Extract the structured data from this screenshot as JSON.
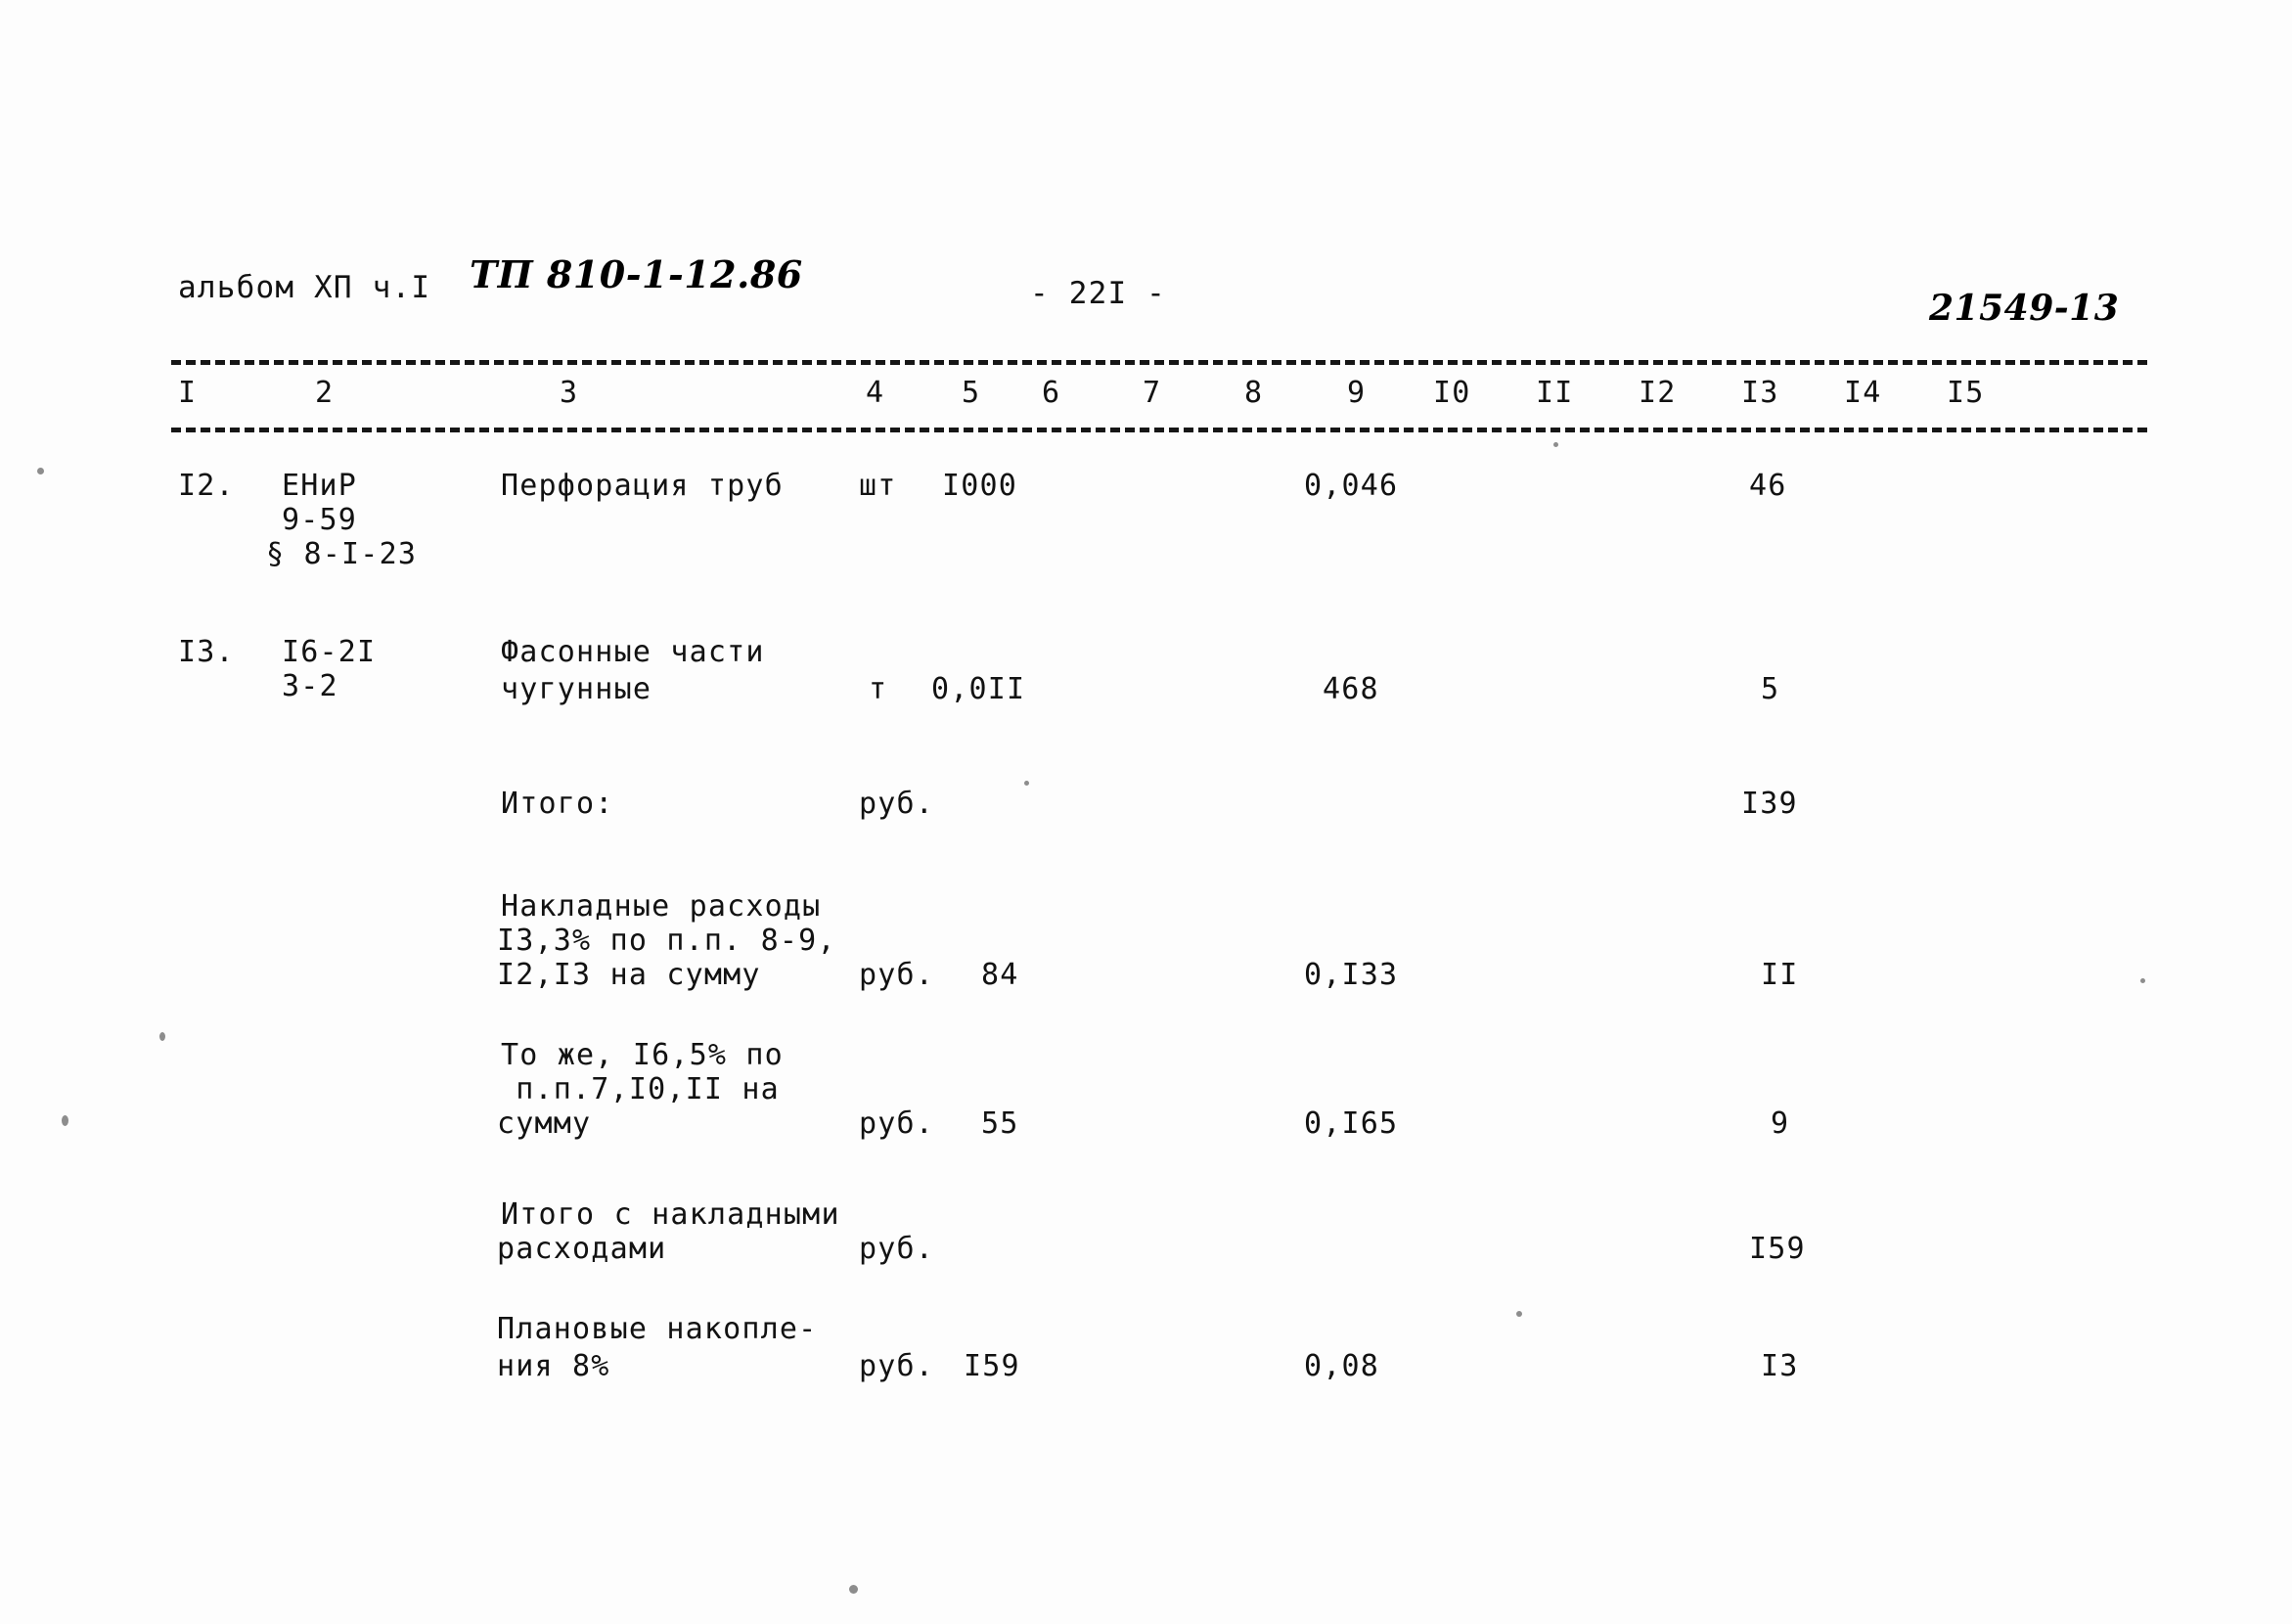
{
  "document": {
    "album_line": "альбом ХП ч.I",
    "project_code_handwritten": "ТП 810-1-12.86",
    "page_number": "- 22I -",
    "stamp_handwritten": "21549-13"
  },
  "table": {
    "column_headers": [
      "I",
      "2",
      "3",
      "4",
      "5",
      "6",
      "7",
      "8",
      "9",
      "I0",
      "II",
      "I2",
      "I3",
      "I4",
      "I5"
    ],
    "rows": [
      {
        "no": "I2.",
        "code_lines": [
          "ЕНиР",
          "9-59",
          "§ 8-I-23"
        ],
        "name_lines": [
          "Перфорация труб"
        ],
        "unit": "шт",
        "qty": "I000",
        "c9": "0,046",
        "c13": "46"
      },
      {
        "no": "I3.",
        "code_lines": [
          "I6-2I",
          "3-2"
        ],
        "name_lines": [
          "Фасонные части",
          "чугунные"
        ],
        "unit": "т",
        "qty": "0,0II",
        "c9": "468",
        "c13": "5"
      },
      {
        "no": "",
        "code_lines": [],
        "name_lines": [
          "Итого:"
        ],
        "unit": "руб.",
        "qty": "",
        "c9": "",
        "c13": "I39"
      },
      {
        "no": "",
        "code_lines": [],
        "name_lines": [
          "Накладные расходы",
          "I3,3% по п.п. 8-9,",
          "I2,I3 на сумму"
        ],
        "unit": "руб.",
        "qty": "84",
        "c9": "0,I33",
        "c13": "II"
      },
      {
        "no": "",
        "code_lines": [],
        "name_lines": [
          "То же, I6,5% по",
          " п.п.7,I0,II на",
          "сумму"
        ],
        "unit": "руб.",
        "qty": "55",
        "c9": "0,I65",
        "c13": "9"
      },
      {
        "no": "",
        "code_lines": [],
        "name_lines": [
          "Итого с накладными",
          "расходами"
        ],
        "unit": "руб.",
        "qty": "",
        "c9": "",
        "c13": "I59"
      },
      {
        "no": "",
        "code_lines": [],
        "name_lines": [
          "Плановые накопле-",
          "ния 8%"
        ],
        "unit": "руб.",
        "qty": "I59",
        "c9": "0,08",
        "c13": "I3"
      }
    ]
  }
}
